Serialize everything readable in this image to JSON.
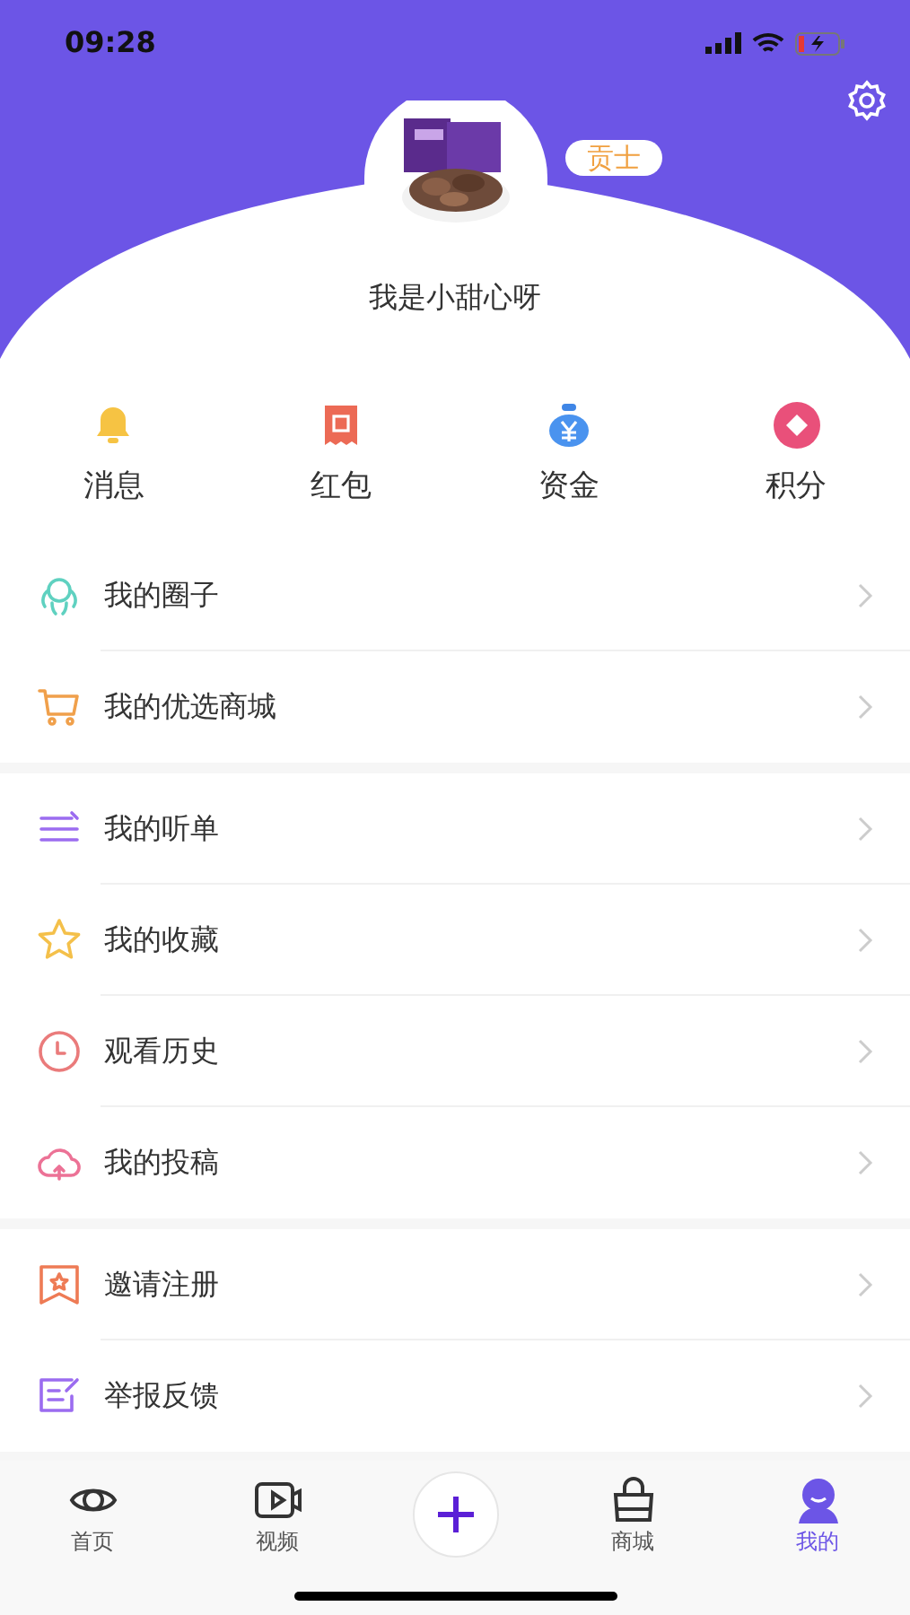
{
  "status_bar": {
    "time": "09:28"
  },
  "profile": {
    "name": "我是小甜心呀",
    "badge": "贡士"
  },
  "shortcuts": [
    {
      "label": "消息"
    },
    {
      "label": "红包"
    },
    {
      "label": "资金"
    },
    {
      "label": "积分"
    }
  ],
  "sections": [
    {
      "items": [
        {
          "label": "我的圈子"
        },
        {
          "label": "我的优选商城"
        }
      ]
    },
    {
      "items": [
        {
          "label": "我的听单"
        },
        {
          "label": "我的收藏"
        },
        {
          "label": "观看历史"
        },
        {
          "label": "我的投稿"
        }
      ]
    },
    {
      "items": [
        {
          "label": "邀请注册"
        },
        {
          "label": "举报反馈"
        }
      ]
    }
  ],
  "tab_bar": [
    {
      "label": "首页",
      "selected": false
    },
    {
      "label": "视频",
      "selected": false
    },
    {
      "kind": "add"
    },
    {
      "label": "商城",
      "selected": false
    },
    {
      "label": "我的",
      "selected": true
    }
  ]
}
